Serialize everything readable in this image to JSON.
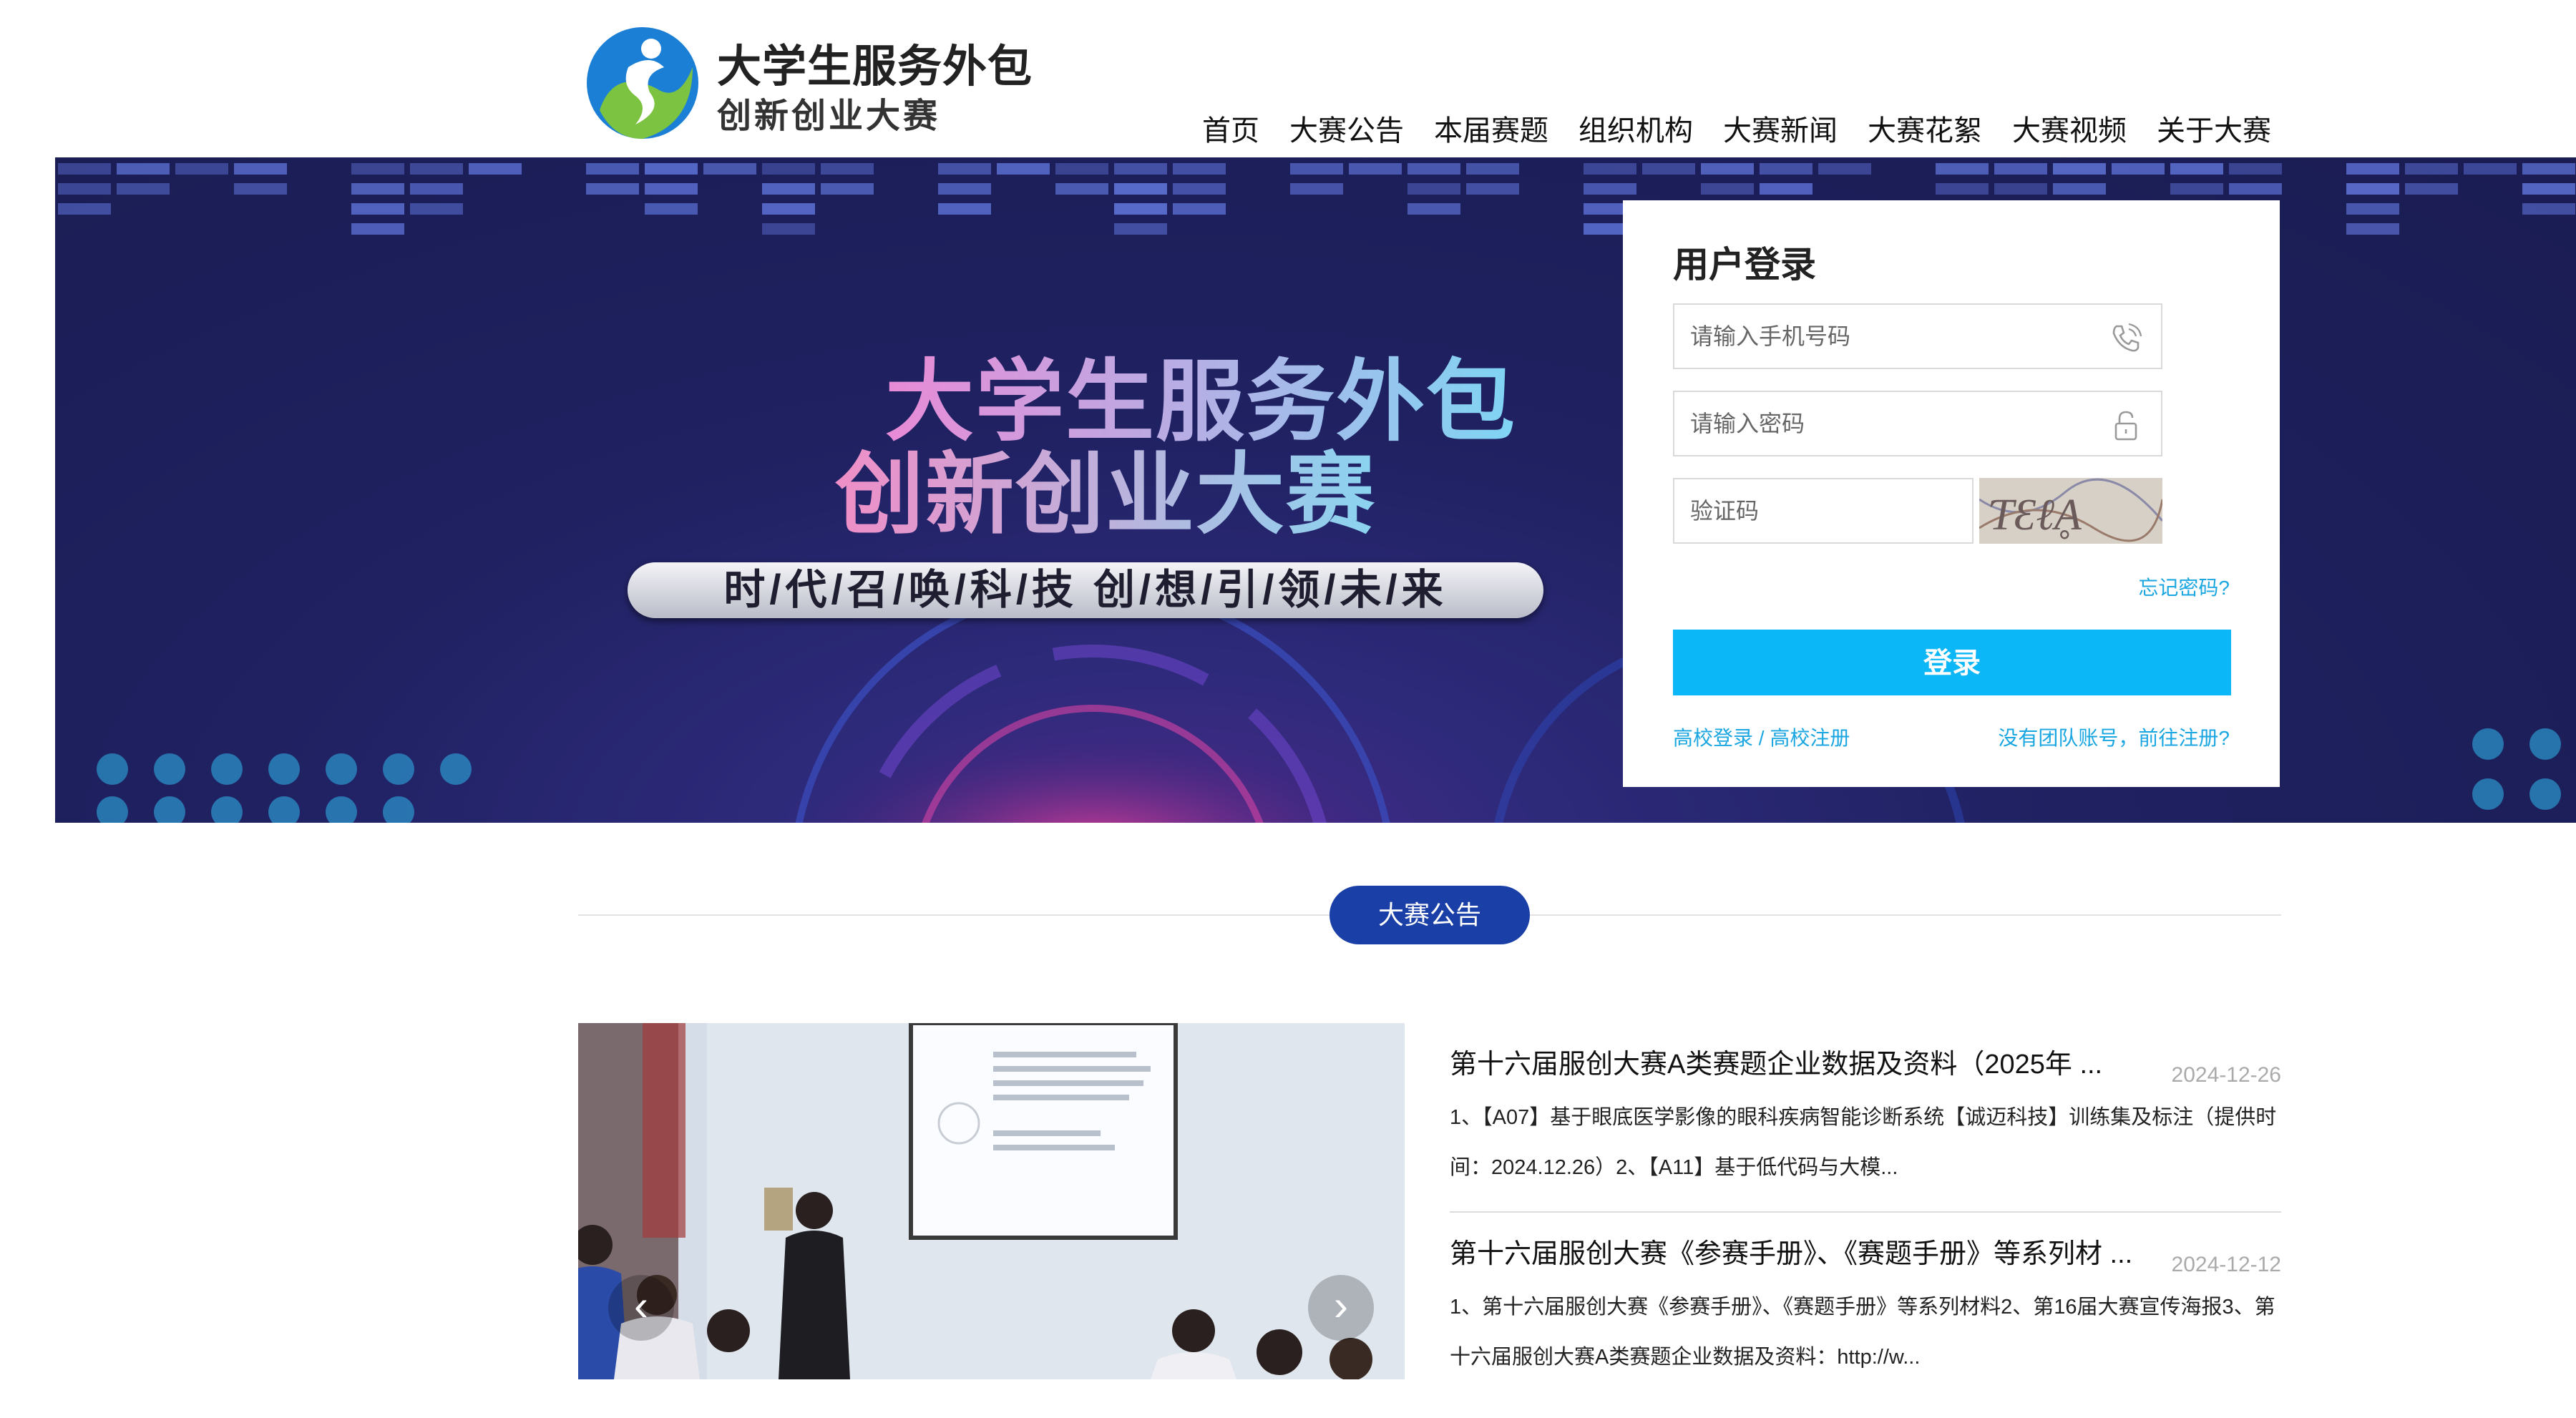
{
  "header": {
    "logo_title": "大学生服务外包",
    "logo_subtitle": "创新创业大赛",
    "nav": [
      "首页",
      "大赛公告",
      "本届赛题",
      "组织机构",
      "大赛新闻",
      "大赛花絮",
      "大赛视频",
      "关于大赛"
    ]
  },
  "banner": {
    "title_line1": "大学生服务外包",
    "title_line2": "创新创业大赛",
    "slogan": "时/代/召/唤/科/技  创/想/引/领/未/来"
  },
  "login": {
    "title": "用户登录",
    "phone_placeholder": "请输入手机号码",
    "password_placeholder": "请输入密码",
    "captcha_placeholder": "验证码",
    "captcha_text": "ƬƐℓḀ",
    "forgot": "忘记密码?",
    "submit": "登录",
    "school_link": "高校登录 / 高校注册",
    "register_link": "没有团队账号，前往注册?"
  },
  "section": {
    "heading": "大赛公告"
  },
  "carousel": {
    "prev": "‹",
    "next": "›"
  },
  "news": [
    {
      "title": "第十六届服创大赛A类赛题企业数据及资料（2025年 ...",
      "date": "2024-12-26",
      "summary": "1、【A07】基于眼底医学影像的眼科疾病智能诊断系统【诚迈科技】训练集及标注（提供时间：2024.12.26）2、【A11】基于低代码与大模..."
    },
    {
      "title": "第十六届服创大赛《参赛手册》、《赛题手册》等系列材 ...",
      "date": "2024-12-12",
      "summary": "1、第十六届服创大赛《参赛手册》、《赛题手册》等系列材料2、第16届大赛宣传海报3、第十六届服创大赛A类赛题企业数据及资料：http://w..."
    }
  ],
  "colors": {
    "accent": "#0bb7f6",
    "section_pill": "#1a3fa6",
    "link": "#1aa6e0",
    "banner_bg": "#1f2161"
  }
}
